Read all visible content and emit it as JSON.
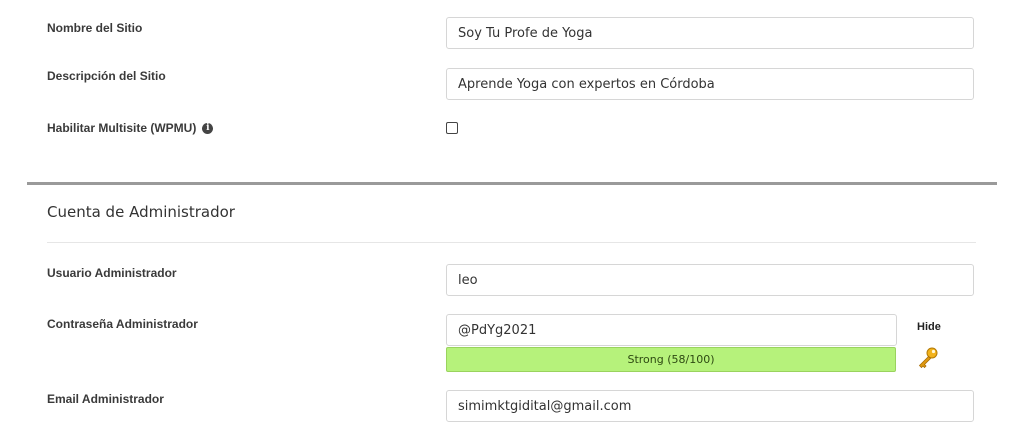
{
  "site": {
    "name_label": "Nombre del Sitio",
    "name_value": "Soy Tu Profe de Yoga",
    "description_label": "Descripción del Sitio",
    "description_value": "Aprende Yoga con expertos en Córdoba",
    "multisite_label": "Habilitar Multisite (WPMU)",
    "multisite_info_icon": "info-icon",
    "multisite_checked": false
  },
  "admin": {
    "section_title": "Cuenta de Administrador",
    "username_label": "Usuario Administrador",
    "username_value": "leo",
    "password_label": "Contraseña Administrador",
    "password_value": "@PdYg2021",
    "password_toggle": "Hide",
    "password_strength": "Strong (58/100)",
    "strength_color": "#b6f27b",
    "generate_icon": "key-icon",
    "email_label": "Email Administrador",
    "email_value": "simimktgidital@gmail.com"
  }
}
